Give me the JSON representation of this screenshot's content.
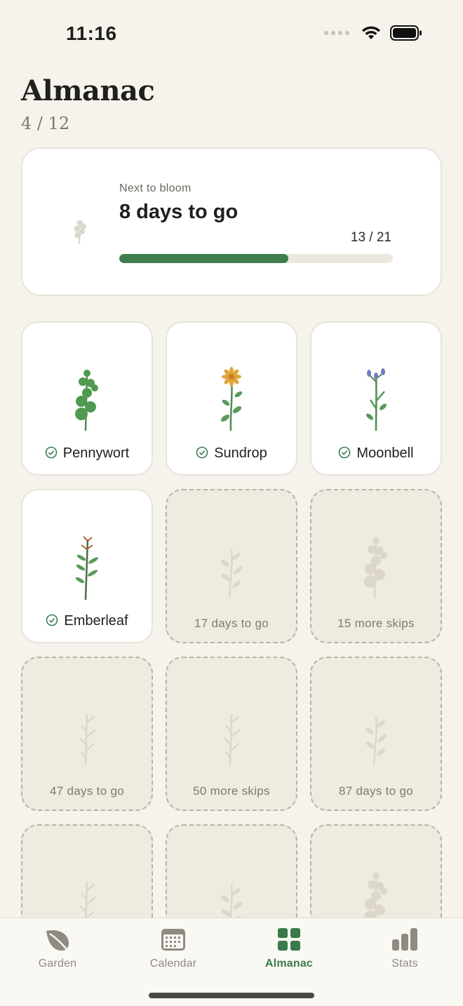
{
  "status_bar": {
    "time": "11:16"
  },
  "header": {
    "title": "Almanac",
    "count": "4 / 12"
  },
  "next_bloom": {
    "label": "Next to bloom",
    "title": "8 days to go",
    "progress_text": "13 / 21",
    "progress_fraction": 0.619
  },
  "tiles": [
    {
      "caption": "Pennywort",
      "state": "unlocked",
      "plant": "pennywort"
    },
    {
      "caption": "Sundrop",
      "state": "unlocked",
      "plant": "sundrop"
    },
    {
      "caption": "Moonbell",
      "state": "unlocked",
      "plant": "moonbell"
    },
    {
      "caption": "Emberleaf",
      "state": "unlocked",
      "plant": "emberleaf"
    },
    {
      "caption": "17 days to go",
      "state": "locked",
      "plant": "sprig"
    },
    {
      "caption": "15 more skips",
      "state": "locked",
      "plant": "pennywort"
    },
    {
      "caption": "47 days to go",
      "state": "locked",
      "plant": "fern"
    },
    {
      "caption": "50 more skips",
      "state": "locked",
      "plant": "fern"
    },
    {
      "caption": "87 days to go",
      "state": "locked",
      "plant": "sprig"
    },
    {
      "caption": "",
      "state": "locked",
      "plant": "fern"
    },
    {
      "caption": "",
      "state": "locked",
      "plant": "sprig"
    },
    {
      "caption": "",
      "state": "locked",
      "plant": "pennywort"
    }
  ],
  "tab_bar": {
    "tabs": [
      {
        "label": "Garden",
        "icon": "leaf-icon",
        "active": false
      },
      {
        "label": "Calendar",
        "icon": "calendar-icon",
        "active": false
      },
      {
        "label": "Almanac",
        "icon": "grid-icon",
        "active": true
      },
      {
        "label": "Stats",
        "icon": "bar-chart-icon",
        "active": false
      }
    ]
  },
  "colors": {
    "background": "#f6f3ec",
    "accent": "#3f7d4f",
    "locked_tile": "#eeebe0",
    "inactive_tab": "#8e8b83"
  }
}
